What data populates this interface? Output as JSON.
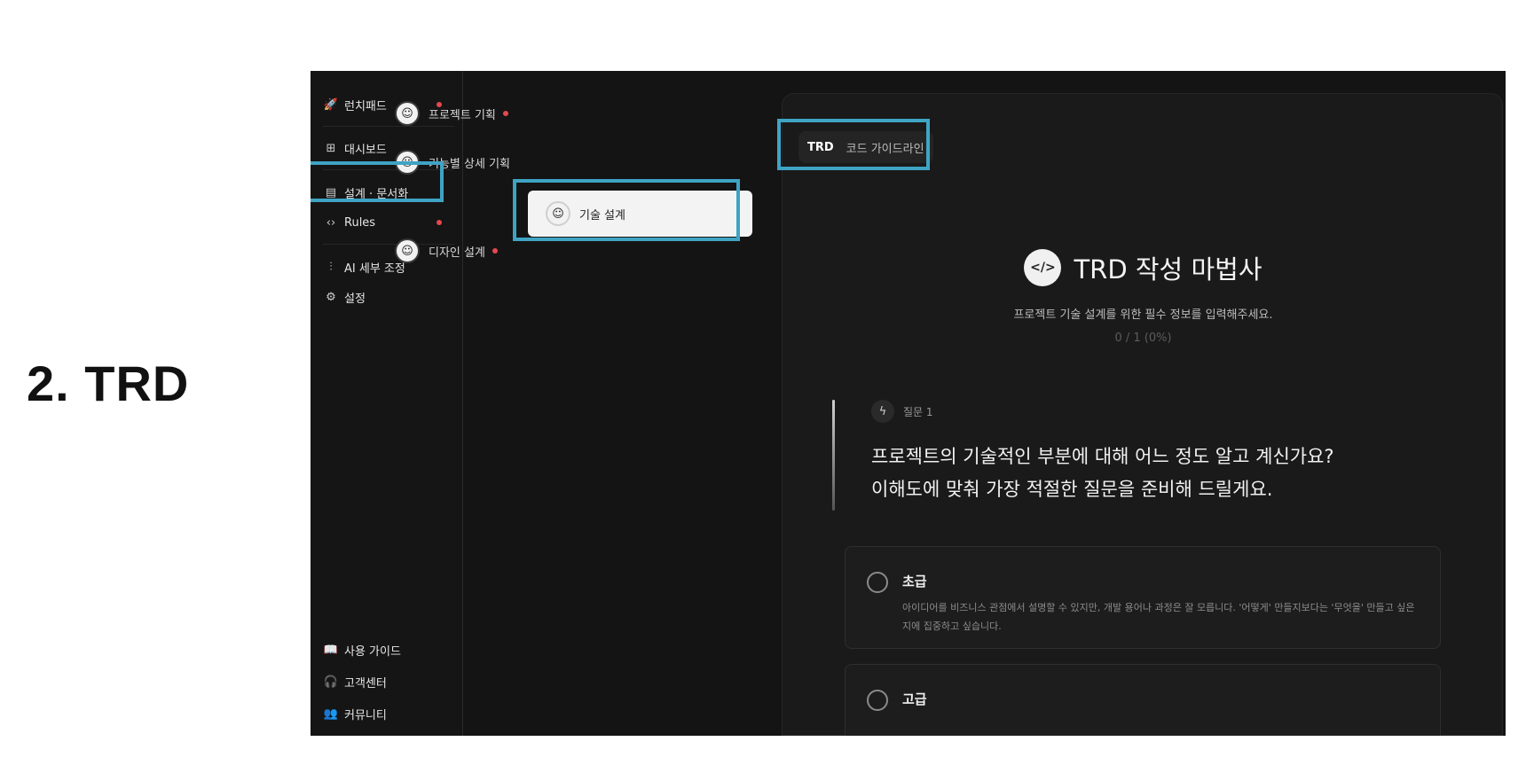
{
  "slide_title": "2. TRD",
  "sidebar": {
    "items": [
      {
        "label": "런치패드",
        "icon": "rocket-icon",
        "glyph": "🚀",
        "dot": true
      },
      {
        "label": "대시보드",
        "icon": "grid-icon",
        "glyph": "⊞",
        "dot": false
      },
      {
        "label": "설계 · 문서화",
        "icon": "document-icon",
        "glyph": "▤",
        "dot": false,
        "selected": true
      },
      {
        "label": "Rules",
        "icon": "code-icon",
        "glyph": "‹›",
        "dot": true
      },
      {
        "label": "AI 세부 조정",
        "icon": "sliders-icon",
        "glyph": "⫶",
        "dot": false
      },
      {
        "label": "설정",
        "icon": "gear-icon",
        "glyph": "⚙",
        "dot": false
      }
    ],
    "bottom_items": [
      {
        "label": "사용 가이드",
        "icon": "book-icon",
        "glyph": "📖"
      },
      {
        "label": "고객센터",
        "icon": "headset-icon",
        "glyph": "🎧"
      },
      {
        "label": "커뮤니티",
        "icon": "users-icon",
        "glyph": "👥"
      }
    ]
  },
  "docs": {
    "items": [
      {
        "label": "프로젝트 기획",
        "dot": true
      },
      {
        "label": "기능별 상세 기획",
        "dot": false
      },
      {
        "label": "기술 설계",
        "active": true
      },
      {
        "label": "디자인 설계",
        "dot": true
      }
    ]
  },
  "main": {
    "tabs": {
      "trd": "TRD",
      "guide": "코드 가이드라인"
    },
    "wizard": {
      "icon_glyph": "</>",
      "title": "TRD 작성 마법사",
      "subtitle": "프로젝트 기술 설계를 위한 필수 정보를 입력해주세요.",
      "progress": "0 / 1 (0%)"
    },
    "question": {
      "tag": "질문 1",
      "line1": "프로젝트의 기술적인 부분에 대해 어느 정도 알고 계신가요?",
      "line2": "이해도에 맞춰 가장 적절한 질문을 준비해 드릴게요."
    },
    "options": [
      {
        "title": "초급",
        "desc": "아이디어를 비즈니스 관점에서 설명할 수 있지만, 개발 용어나 과정은 잘 모릅니다. '어떻게' 만들지보다는 '무엇을' 만들고 싶은지에 집중하고 싶습니다."
      },
      {
        "title": "고급",
        "desc": ""
      }
    ]
  },
  "colors": {
    "highlight": "#3fa4c4",
    "dot": "#e5484d",
    "background": "#141414"
  }
}
